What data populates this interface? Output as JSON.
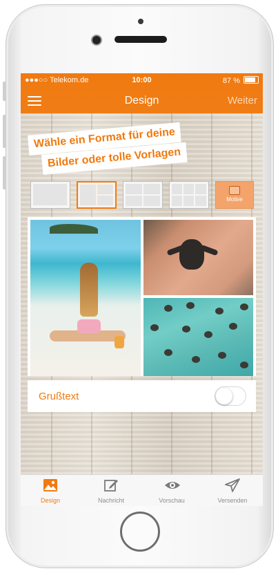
{
  "status_bar": {
    "carrier": "●●●○○ Telekom.de",
    "time": "10:00",
    "battery": "87 %"
  },
  "nav": {
    "title": "Design",
    "right_button": "Weiter"
  },
  "banner": {
    "line1": "Wähle ein Format für deine",
    "line2": "Bilder oder tolle Vorlagen"
  },
  "formats": {
    "motive_label": "Motive",
    "selected_index": 1
  },
  "greeting": {
    "label": "Grußtext",
    "enabled": false
  },
  "tabs": [
    {
      "label": "Design",
      "icon": "image-icon",
      "active": true
    },
    {
      "label": "Nachricht",
      "icon": "edit-icon",
      "active": false
    },
    {
      "label": "Vorschau",
      "icon": "eye-icon",
      "active": false
    },
    {
      "label": "Versenden",
      "icon": "send-icon",
      "active": false
    }
  ],
  "colors": {
    "accent": "#f07a10"
  }
}
